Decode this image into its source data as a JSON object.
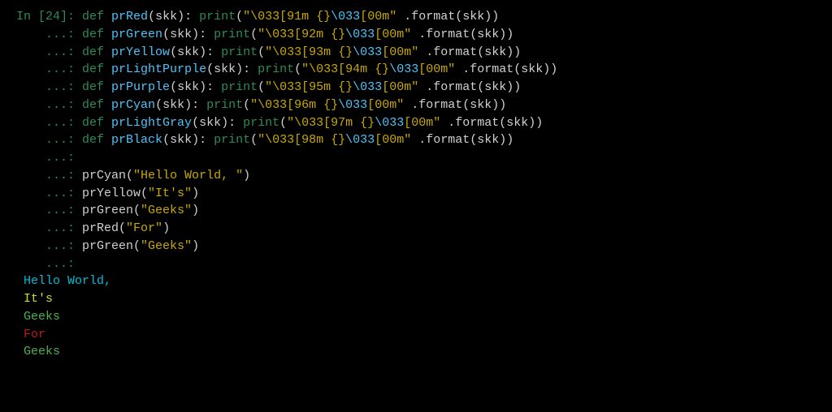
{
  "prompt": {
    "primary": "In [24]: ",
    "cont": "    ...: "
  },
  "defs": [
    {
      "name": "prRed",
      "pre": "\"\\033[91m {}",
      "esc2": "\\033",
      "post": "[00m\""
    },
    {
      "name": "prGreen",
      "pre": "\"\\033[92m {}",
      "esc2": "\\033",
      "post": "[00m\""
    },
    {
      "name": "prYellow",
      "pre": "\"\\033[93m {}",
      "esc2": "\\033",
      "post": "[00m\""
    },
    {
      "name": "prLightPurple",
      "pre": "\"\\033[94m {}",
      "esc2": "\\033",
      "post": "[00m\""
    },
    {
      "name": "prPurple",
      "pre": "\"\\033[95m {}",
      "esc2": "\\033",
      "post": "[00m\""
    },
    {
      "name": "prCyan",
      "pre": "\"\\033[96m {}",
      "esc2": "\\033",
      "post": "[00m\""
    },
    {
      "name": "prLightGray",
      "pre": "\"\\033[97m {}",
      "esc2": "\\033",
      "post": "[00m\""
    },
    {
      "name": "prBlack",
      "pre": "\"\\033[98m {}",
      "esc2": "\\033",
      "post": "[00m\""
    }
  ],
  "common": {
    "def": "def",
    "print": "print",
    "param": "skk",
    "format_call": " .format(skk))"
  },
  "calls": [
    {
      "fn": "prCyan",
      "arg": "\"Hello World, \""
    },
    {
      "fn": "prYellow",
      "arg": "\"It's\""
    },
    {
      "fn": "prGreen",
      "arg": "\"Geeks\""
    },
    {
      "fn": "prRed",
      "arg": "\"For\""
    },
    {
      "fn": "prGreen",
      "arg": "\"Geeks\""
    }
  ],
  "output": [
    {
      "text": " Hello World, ",
      "class": "out-cyan"
    },
    {
      "text": " It's",
      "class": "out-yellow"
    },
    {
      "text": " Geeks",
      "class": "out-green"
    },
    {
      "text": " For",
      "class": "out-red"
    },
    {
      "text": " Geeks",
      "class": "out-green"
    }
  ]
}
